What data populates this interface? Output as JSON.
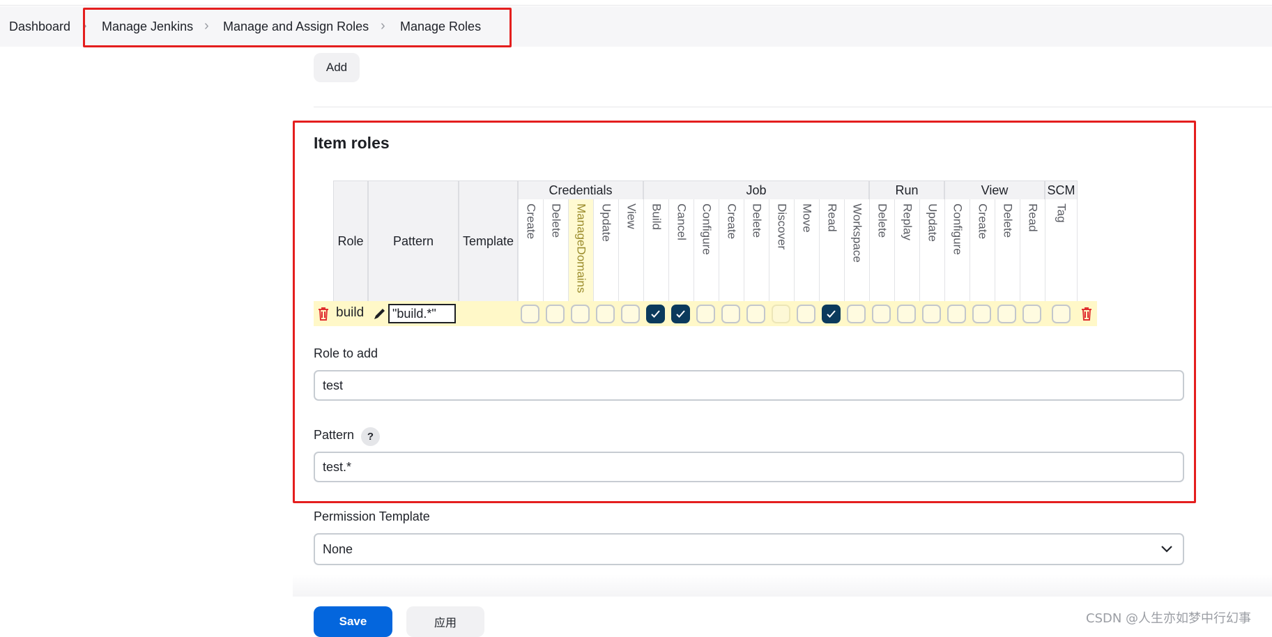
{
  "breadcrumb": [
    "Dashboard",
    "Manage Jenkins",
    "Manage and Assign Roles",
    "Manage Roles"
  ],
  "add_button": "Add",
  "section_title": "Item roles",
  "table": {
    "fixed_headers": [
      "Role",
      "Pattern",
      "Template"
    ],
    "groups": [
      "Credentials",
      "Job",
      "Run",
      "View",
      "SCM"
    ],
    "permissions": [
      "Create",
      "Delete",
      "ManageDomains",
      "Update",
      "View",
      "Build",
      "Cancel",
      "Configure",
      "Create",
      "Delete",
      "Discover",
      "Move",
      "Read",
      "Workspace",
      "Delete",
      "Replay",
      "Update",
      "Configure",
      "Create",
      "Delete",
      "Read",
      "Tag"
    ],
    "highlighted_permission": "ManageDomains",
    "row": {
      "role": "build",
      "pattern": "\"build.*\"",
      "checked": [
        "Build",
        "Cancel",
        "Read"
      ],
      "disabled": [
        "Discover"
      ]
    }
  },
  "role_to_add": {
    "label": "Role to add",
    "value": "test"
  },
  "pattern": {
    "label": "Pattern",
    "help": "?",
    "value": "test.*"
  },
  "permission_template": {
    "label": "Permission Template",
    "value": "None"
  },
  "save_button": "Save",
  "apply_button": "应用",
  "watermark": "CSDN @人生亦如梦中行幻事",
  "colors": {
    "primary": "#0466dd",
    "checked": "#0b3a5c",
    "highlight_row": "#fff8c8",
    "annotation": "#e41e1e",
    "delete": "#e03030"
  }
}
